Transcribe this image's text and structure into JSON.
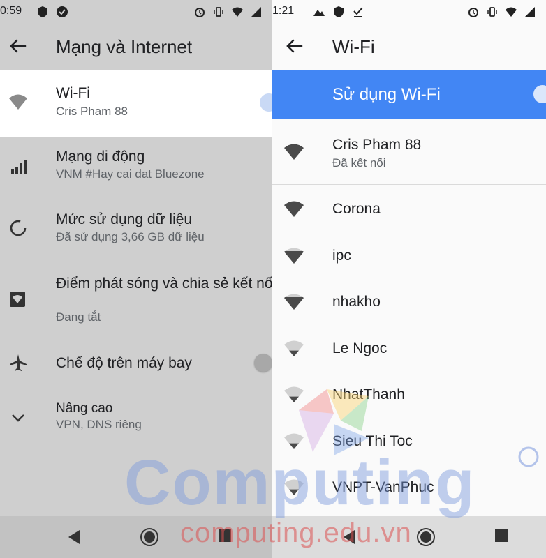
{
  "left": {
    "status_time": "0:59",
    "title": "Mạng và Internet",
    "wifi": {
      "title": "Wi-Fi",
      "subtitle": "Cris Pham 88"
    },
    "items": [
      {
        "title": "Mạng di động",
        "subtitle": "VNM #Hay cai dat Bluezone",
        "icon": "cellular-signal-icon"
      },
      {
        "title": "Mức sử dụng dữ liệu",
        "subtitle": "Đã sử dụng 3,66 GB dữ liệu",
        "icon": "data-usage-icon"
      },
      {
        "title": "Điểm phát sóng và chia sẻ kết nối",
        "subtitle": "Đang tắt",
        "icon": "hotspot-icon"
      },
      {
        "title": "Chế độ trên máy bay",
        "subtitle": "",
        "icon": "airplane-icon"
      },
      {
        "title": "Nâng cao",
        "subtitle": "VPN, DNS riêng",
        "icon": "chevron-down-icon"
      }
    ]
  },
  "right": {
    "status_time": "1:21",
    "title": "Wi-Fi",
    "use_wifi_label": "Sử dụng Wi-Fi",
    "connected": {
      "name": "Cris Pham 88",
      "status": "Đã kết nối"
    },
    "networks": [
      {
        "name": "Corona",
        "strength": 4
      },
      {
        "name": "ipc",
        "strength": 3
      },
      {
        "name": "nhakho",
        "strength": 3
      },
      {
        "name": "Le Ngoc",
        "strength": 1
      },
      {
        "name": "NhatThanh",
        "strength": 1
      },
      {
        "name": "Sieu Thi Toc",
        "strength": 1
      },
      {
        "name": "VNPT-VanPhuc",
        "strength": 1
      }
    ]
  },
  "watermark": {
    "brand": "Computing",
    "domain": "computing.edu.vn"
  },
  "colors": {
    "accent": "#4286f4",
    "overlay": "#cfcfcf"
  }
}
